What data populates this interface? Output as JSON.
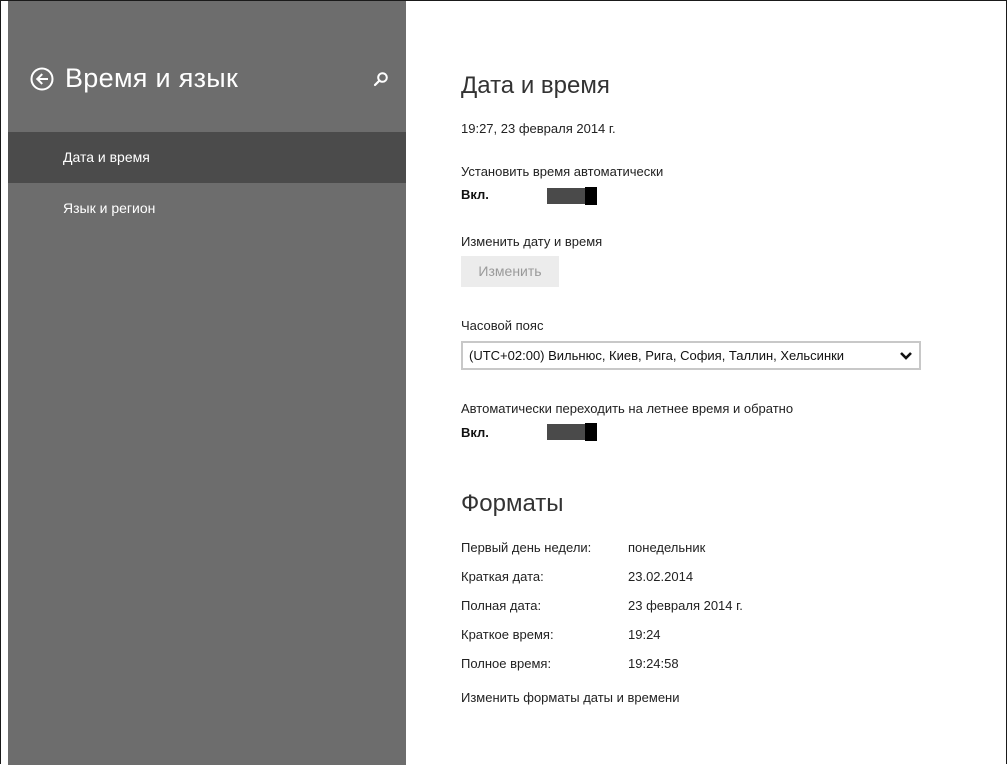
{
  "sidebar": {
    "title": "Время и язык",
    "items": [
      {
        "label": "Дата и время",
        "selected": true
      },
      {
        "label": "Язык и регион",
        "selected": false
      }
    ],
    "back_icon": "back-arrow-circle-icon",
    "search_icon": "search-icon"
  },
  "main": {
    "date_time_heading": "Дата и время",
    "current_datetime": "19:27, 23 февраля 2014 г.",
    "auto_time": {
      "label": "Установить время автоматически",
      "state": "Вкл."
    },
    "change_datetime": {
      "label": "Изменить дату и время",
      "button": "Изменить"
    },
    "timezone": {
      "label": "Часовой пояс",
      "value": "(UTC+02:00) Вильнюс, Киев, Рига, София, Таллин, Хельсинки"
    },
    "dst": {
      "label": "Автоматически переходить на летнее время и обратно",
      "state": "Вкл."
    },
    "formats_heading": "Форматы",
    "formats": [
      {
        "label": "Первый день недели:",
        "value": "понедельник"
      },
      {
        "label": "Краткая дата:",
        "value": "23.02.2014"
      },
      {
        "label": "Полная дата:",
        "value": "23 февраля 2014 г."
      },
      {
        "label": "Краткое время:",
        "value": "19:24"
      },
      {
        "label": "Полное время:",
        "value": "19:24:58"
      }
    ],
    "change_formats_link": "Изменить форматы даты и времени"
  },
  "colors": {
    "sidebar_bg": "#6d6d6d",
    "sidebar_selected": "#4b4b4b",
    "toggle_track": "#4a4a4a",
    "toggle_knob": "#000000"
  }
}
